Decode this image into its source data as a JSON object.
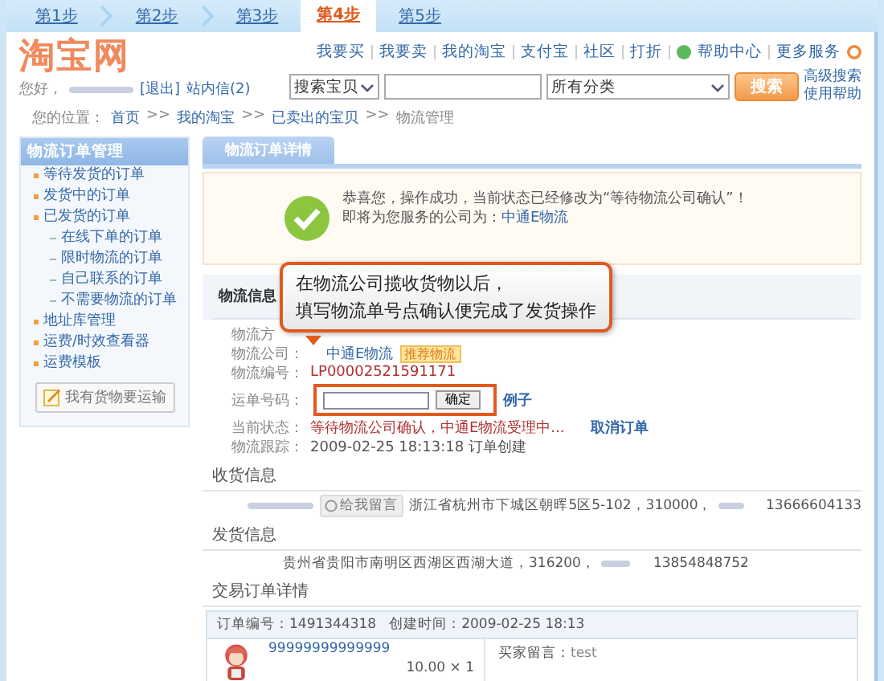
{
  "steps": [
    {
      "label": "第1步",
      "selected": false
    },
    {
      "label": "第2步",
      "selected": false
    },
    {
      "label": "第3步",
      "selected": false
    },
    {
      "label": "第4步",
      "selected": true
    },
    {
      "label": "第5步",
      "selected": false
    }
  ],
  "logo": "淘宝网",
  "user": {
    "greeting": "您好，",
    "logout": "[退出]",
    "messages": "站内信(2)"
  },
  "top_links": [
    "我要买",
    "我要卖",
    "我的淘宝",
    "支付宝",
    "社区",
    "打折",
    "帮助中心",
    "更多服务"
  ],
  "search": {
    "scope": "搜索宝贝",
    "category": "所有分类",
    "button": "搜索",
    "links": [
      "高级搜索",
      "使用帮助"
    ]
  },
  "breadcrumb": {
    "label": "您的位置：",
    "items": [
      "首页",
      "我的淘宝",
      "已卖出的宝贝",
      "物流管理"
    ],
    "separator": ">>"
  },
  "sidebar": {
    "title": "物流订单管理",
    "items": [
      {
        "label": "等待发货的订单"
      },
      {
        "label": "发货中的订单"
      },
      {
        "label": "已发货的订单",
        "children": [
          {
            "label": "在线下单的订单"
          },
          {
            "label": "限时物流的订单"
          },
          {
            "label": "自己联系的订单"
          },
          {
            "label": "不需要物流的订单"
          }
        ]
      },
      {
        "label": "地址库管理"
      },
      {
        "label": "运费/时效查看器"
      },
      {
        "label": "运费模板"
      }
    ],
    "button": "我有货物要运输"
  },
  "tab": "物流订单详情",
  "success": {
    "message": "恭喜您，操作成功，当前状态已经修改为“等待物流公司确认”！",
    "company_label": "即将为您服务的公司为：",
    "company": "中通E物流"
  },
  "logistics": {
    "title": "物流信息",
    "method_label": "物流方",
    "company_label": "物流公司：",
    "company": "中通E物流",
    "badge": "推荐物流",
    "number_label": "物流编号：",
    "number": "LP00002521591171",
    "waybill_label": "运单号码：",
    "confirm": "确定",
    "example": "例子",
    "status_label": "当前状态：",
    "status": "等待物流公司确认，中通E物流受理中...",
    "cancel": "取消订单",
    "tracking_label": "物流跟踪：",
    "tracking": "2009-02-25 18:13:18  订单创建"
  },
  "callout": [
    "在物流公司揽收货物以后，",
    "填写物流单号点确认便完成了发货操作"
  ],
  "receiver": {
    "title": "收货信息",
    "badge": "给我留言",
    "address": "浙江省杭州市下城区朝晖5区5-102，310000，",
    "phone": "13666604133"
  },
  "sender": {
    "title": "发货信息",
    "address": "贵州省贵阳市南明区西湖区西湖大道，316200，",
    "phone": "13854848752"
  },
  "order": {
    "title": "交易订单详情",
    "number": "订单编号：1491344318",
    "created": "创建时间：2009-02-25 18:13",
    "item": "99999999999999",
    "price": "10.00 × 1",
    "note_label": "买家留言：",
    "note": "test"
  }
}
